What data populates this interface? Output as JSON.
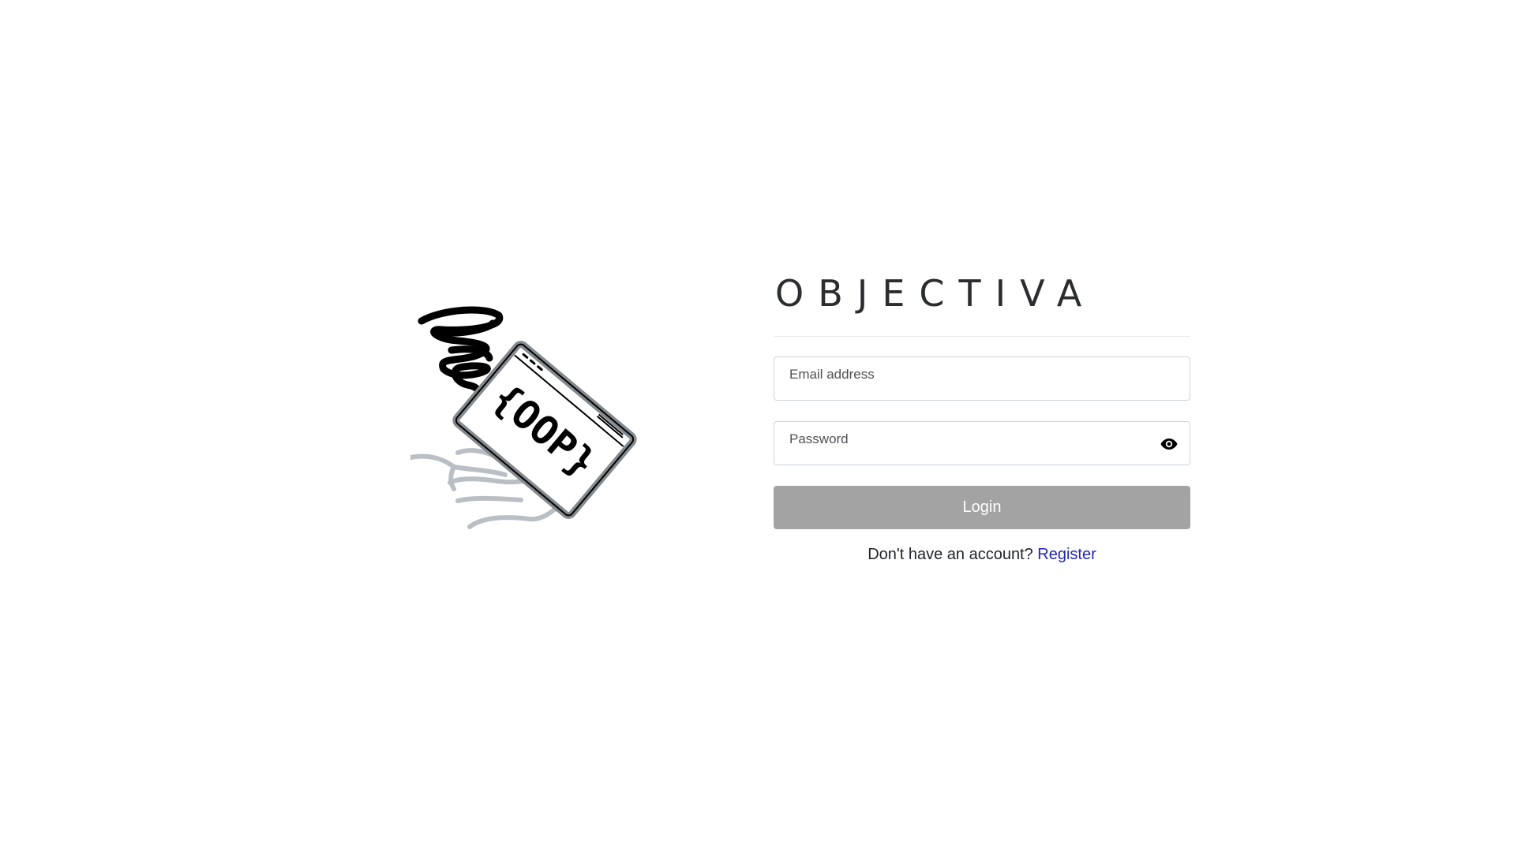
{
  "brand": {
    "title": "OBJECTIVA",
    "logo": {
      "name": "oop-logo-illustration",
      "text": "{OOP}",
      "description_icons": [
        "tornado-scribble",
        "browser-window",
        "hand"
      ]
    }
  },
  "form": {
    "email": {
      "label": "Email address",
      "value": ""
    },
    "password": {
      "label": "Password",
      "value": "",
      "toggle_icon": "eye-icon"
    },
    "login_label": "Login"
  },
  "footer": {
    "prompt": "Don't have an account?",
    "register_label": "Register"
  },
  "colors": {
    "title": "#2b2d31",
    "button_disabled": "#a3a3a3",
    "link": "#2326b5",
    "field_border": "#ced4da",
    "divider": "#e7e8ea"
  }
}
